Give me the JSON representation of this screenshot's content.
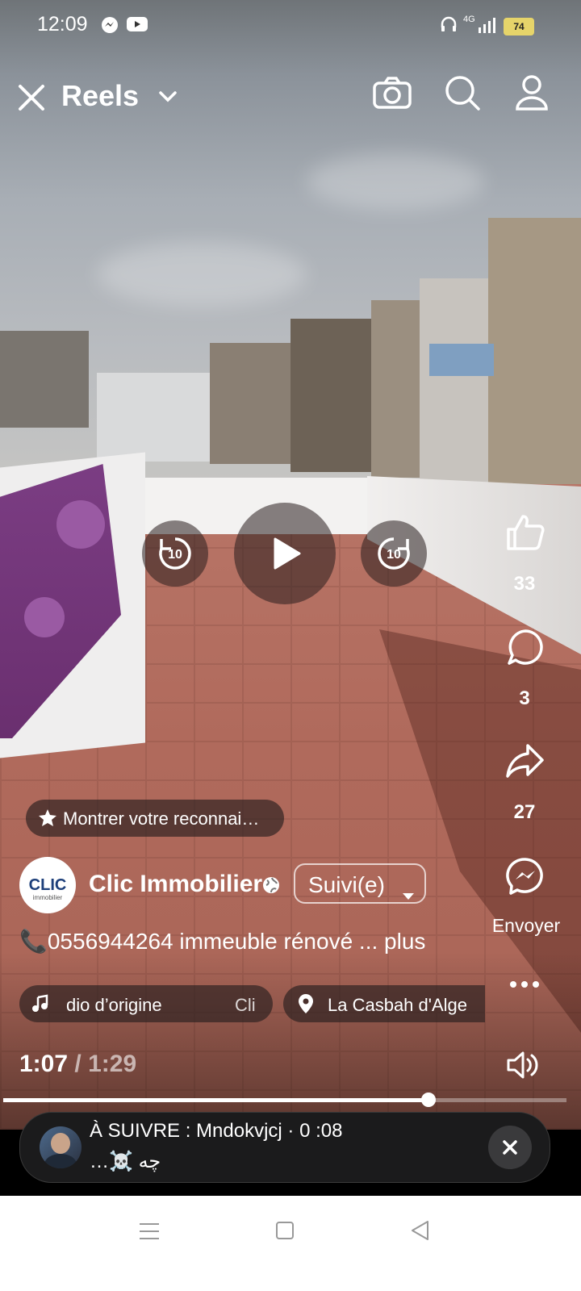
{
  "status_bar": {
    "time": "12:09",
    "network": "4G",
    "battery": "74"
  },
  "header": {
    "title": "Reels"
  },
  "player": {
    "rewind_label": "10",
    "forward_label": "10",
    "current_time": "1:07",
    "separator": "/",
    "duration": "1:29",
    "progress": 0.755
  },
  "side_actions": {
    "likes": "33",
    "comments": "3",
    "shares": "27",
    "send_label": "Envoyer"
  },
  "support_prompt": "Montrer votre reconnai…",
  "author": {
    "name": "Clic Immobilier",
    "follow_label": "Suivi(e)",
    "logo_text": "CLIC",
    "logo_subtext": "immobilier"
  },
  "caption": {
    "text": "📞0556944264 immeuble rénové",
    "more": "... plus"
  },
  "audio_pill": {
    "text": "dio d’origine",
    "artist": "Cli"
  },
  "location_pill": {
    "text": "La Casbah d'Alge"
  },
  "up_next": {
    "label": "À SUIVRE : Mndokvjcj · 0 :08",
    "subtitle": "…☠️ چه"
  }
}
